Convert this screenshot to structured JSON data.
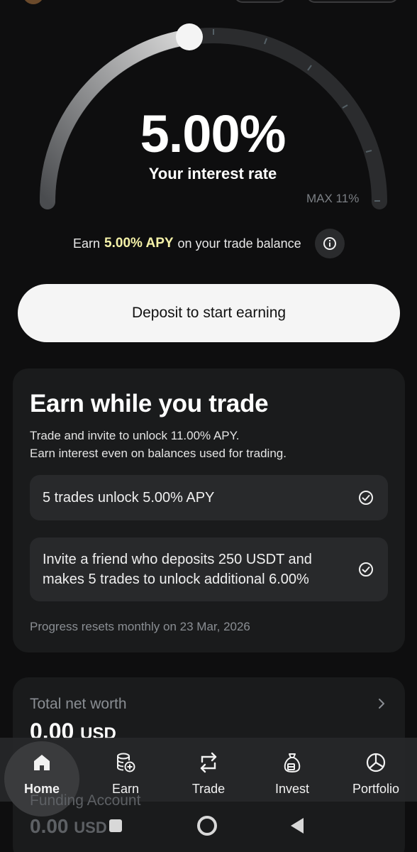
{
  "gauge": {
    "rate": "5.00%",
    "rate_label": "Your interest rate",
    "max_label": "MAX 11%",
    "progress_fraction": 0.4545
  },
  "earn": {
    "prefix": "Earn",
    "highlight": "5.00% APY",
    "suffix": "on your trade balance",
    "info_icon": "info-icon"
  },
  "deposit_button": "Deposit to start earning",
  "trade_card": {
    "title": "Earn while you trade",
    "subtitle_line1": "Trade and invite to unlock 11.00% APY.",
    "subtitle_line2": "Earn interest even on balances used for trading.",
    "tasks": [
      {
        "label": "5 trades unlock 5.00% APY",
        "icon": "check-circle-icon"
      },
      {
        "label": "Invite a friend who deposits 250 USDT and makes 5 trades to unlock additional 6.00%",
        "icon": "check-circle-icon"
      }
    ],
    "reset_note": "Progress resets monthly on 23 Mar, 2026"
  },
  "worth_card": {
    "label": "Total net worth",
    "value": "0.00",
    "currency": "USD",
    "funding_label": "Funding Account",
    "funding_value": "0.00",
    "funding_currency": "USD"
  },
  "nav": {
    "items": [
      {
        "label": "Home",
        "icon": "home-icon",
        "active": true
      },
      {
        "label": "Earn",
        "icon": "coins-plus-icon"
      },
      {
        "label": "Trade",
        "icon": "swap-arrows-icon"
      },
      {
        "label": "Invest",
        "icon": "money-bag-icon"
      },
      {
        "label": "Portfolio",
        "icon": "pie-chart-icon"
      }
    ]
  },
  "colors": {
    "background": "#0e0e0f",
    "card": "#1a1b1c",
    "highlight": "#f4f1a8"
  }
}
